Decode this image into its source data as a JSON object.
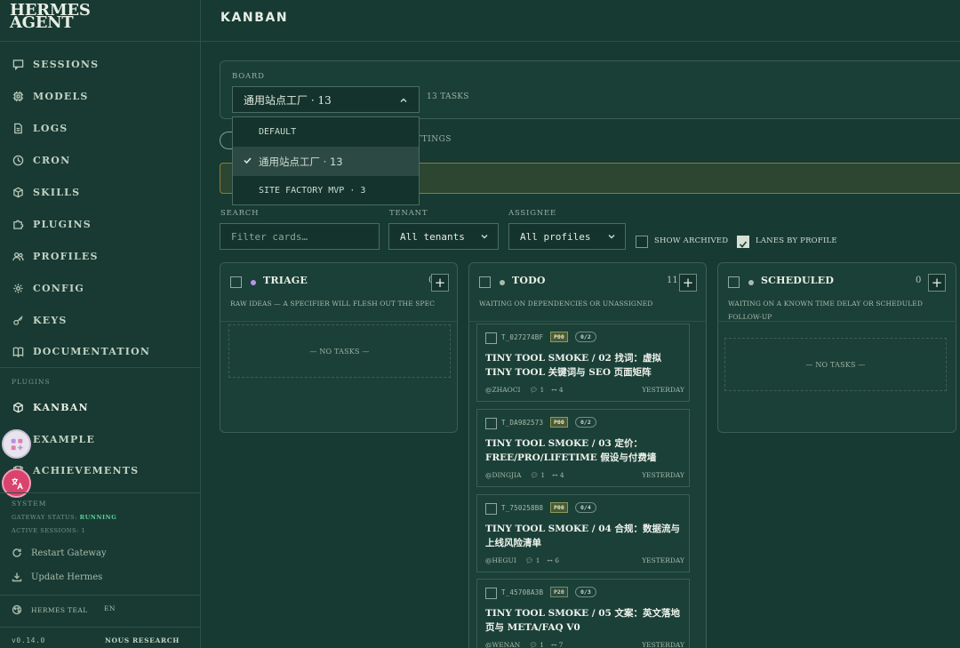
{
  "brand": {
    "line1": "HERMES",
    "line2": "AGENT"
  },
  "nav": [
    {
      "key": "sessions",
      "label": "SESSIONS",
      "icon": "chat-icon"
    },
    {
      "key": "models",
      "label": "MODELS",
      "icon": "chip-icon"
    },
    {
      "key": "logs",
      "label": "LOGS",
      "icon": "file-icon"
    },
    {
      "key": "cron",
      "label": "CRON",
      "icon": "clock-icon"
    },
    {
      "key": "skills",
      "label": "SKILLS",
      "icon": "cube-icon"
    },
    {
      "key": "plugins",
      "label": "PLUGINS",
      "icon": "puzzle-icon"
    },
    {
      "key": "profiles",
      "label": "PROFILES",
      "icon": "users-icon"
    },
    {
      "key": "config",
      "label": "CONFIG",
      "icon": "gear-icon"
    },
    {
      "key": "keys",
      "label": "KEYS",
      "icon": "key-icon"
    },
    {
      "key": "documentation",
      "label": "DOCUMENTATION",
      "icon": "book-icon"
    }
  ],
  "plugins_label": "PLUGINS",
  "plugin_nav": [
    {
      "key": "kanban",
      "label": "KANBAN",
      "icon": "cube-icon",
      "active": true
    },
    {
      "key": "example",
      "label": "EXAMPLE",
      "icon": "puzzle-icon"
    },
    {
      "key": "achievements",
      "label": "ACHIEVEMENTS",
      "icon": "trophy-icon"
    }
  ],
  "system": {
    "label": "SYSTEM",
    "gateway_label": "GATEWAY STATUS:",
    "gateway_status": "RUNNING",
    "sessions_label": "ACTIVE SESSIONS:",
    "sessions_value": "1",
    "restart": "Restart Gateway",
    "update": "Update Hermes"
  },
  "footer": {
    "theme": "HERMES TEAL",
    "lang": "EN",
    "version": "v0.14.0",
    "vendor": "NOUS RESEARCH"
  },
  "page_title": "KANBAN",
  "board": {
    "label": "BOARD",
    "selected": "通用站点工厂 · 13",
    "tasks_count": "13 TASKS",
    "options": [
      {
        "label": "DEFAULT",
        "selected": false
      },
      {
        "label": "通用站点工厂 · 13",
        "selected": true
      },
      {
        "label": "SITE FACTORY MVP · 3",
        "selected": false
      }
    ],
    "settings_partial": "TTINGS"
  },
  "filters": {
    "search_label": "SEARCH",
    "search_placeholder": "Filter cards…",
    "tenant_label": "TENANT",
    "tenant_value": "All tenants",
    "assignee_label": "ASSIGNEE",
    "assignee_value": "All profiles",
    "show_archived": "SHOW ARCHIVED",
    "show_archived_checked": false,
    "lanes_by_profile": "LANES BY PROFILE",
    "lanes_by_profile_checked": true
  },
  "colors": {
    "triage": "#b994e6",
    "todo": "#a9bbab",
    "scheduled": "#a9bbab",
    "running": "#59d39a",
    "accent": "#e6eee4"
  },
  "columns": [
    {
      "key": "triage",
      "title": "TRIAGE",
      "count": "0",
      "subtitle": "RAW IDEAS — A SPECIFIER WILL FLESH OUT THE SPEC",
      "empty": "— NO TASKS —"
    },
    {
      "key": "todo",
      "title": "TODO",
      "count": "11",
      "subtitle": "WAITING ON DEPENDENCIES OR UNASSIGNED"
    },
    {
      "key": "scheduled",
      "title": "SCHEDULED",
      "count": "0",
      "subtitle": "WAITING ON A KNOWN TIME DELAY OR SCHEDULED FOLLOW-UP",
      "empty": "— NO TASKS —"
    }
  ],
  "todo_cards": [
    {
      "id": "T_027274BF",
      "priority": "P00",
      "progress": "0/2",
      "title": "TINY TOOL SMOKE / 02 找词：虚拟 TINY TOOL 关键词与 SEO 页面矩阵",
      "assignee": "@ZHAOCI",
      "comments": "1",
      "links": "4",
      "when": "YESTERDAY"
    },
    {
      "id": "T_DA982573",
      "priority": "P00",
      "progress": "0/2",
      "title": "TINY TOOL SMOKE / 03 定价：FREE/PRO/LIFETIME 假设与付费墙",
      "assignee": "@DINGJIA",
      "comments": "1",
      "links": "4",
      "when": "YESTERDAY"
    },
    {
      "id": "T_750258B8",
      "priority": "P00",
      "progress": "0/4",
      "title": "TINY TOOL SMOKE / 04 合规：数据流与上线风险清单",
      "assignee": "@HEGUI",
      "comments": "1",
      "links": "6",
      "when": "YESTERDAY"
    },
    {
      "id": "T_45708A3B",
      "priority": "P20",
      "progress": "0/3",
      "title": "TINY TOOL SMOKE / 05 文案：英文落地页与 META/FAQ V0",
      "assignee": "@WENAN",
      "comments": "1",
      "links": "7",
      "when": "YESTERDAY"
    }
  ]
}
